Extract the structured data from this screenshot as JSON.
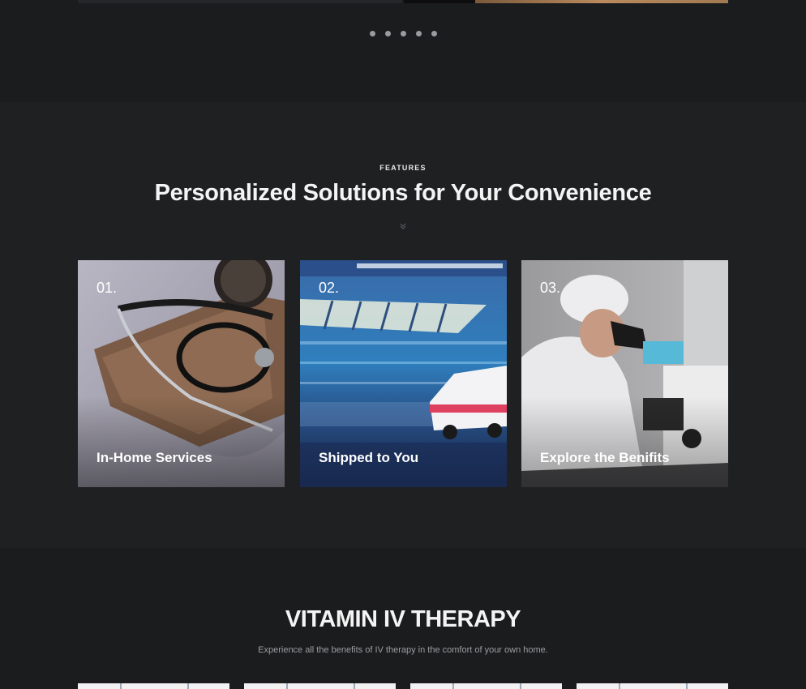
{
  "slider": {
    "dots": [
      1,
      2,
      3,
      4,
      5
    ]
  },
  "features": {
    "eyebrow": "FEATURES",
    "headline": "Personalized Solutions for Your Convenience",
    "cards": [
      {
        "number": "01.",
        "title": "In-Home Services"
      },
      {
        "number": "02.",
        "title": "Shipped to You"
      },
      {
        "number": "03.",
        "title": "Explore the Benifits"
      }
    ]
  },
  "vitamin": {
    "title": "VITAMIN IV THERAPY",
    "subtitle": "Experience all the benefits of IV therapy in the comfort of your own home."
  }
}
